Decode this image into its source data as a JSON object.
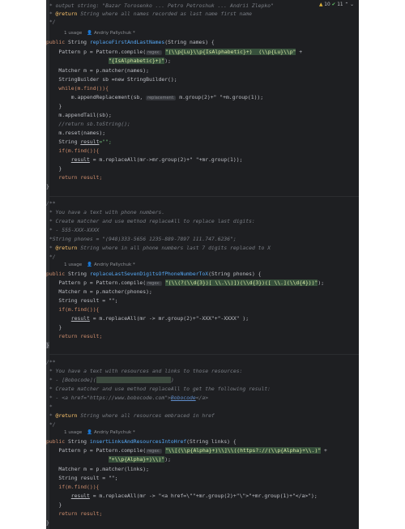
{
  "warnings": {
    "warn_count": "10",
    "ok_count": "11"
  },
  "top": {
    "l1": " * output string: \"Bazar Torosenko ... Petro Petroshuk ... Andrii Zlepko\"",
    "l2_tag": "@return",
    "l2": " String where all names recorded as last name first name",
    "l3": " */"
  },
  "usages": {
    "label": "1 usage",
    "author": "Andriy Pallychuk *"
  },
  "m1": {
    "sig_kw": "public ",
    "sig_type": "String ",
    "sig_name": "replaceFirstAndLastNames",
    "sig_params": "(String names) {",
    "p_decl": "    Pattern p = Pattern.compile(",
    "p_hint": "regex:",
    "p_rx1": "\"(\\\\p{Lu}\\\\p{IsAlphabetic}+)  (\\\\p{Lu}\\\\p\"",
    "p_plus": " +",
    "p_rx2": "\"{IsAlphabetic}+)\"",
    "p_end": ");",
    "m_line": "    Matcher m = p.matcher(names);",
    "sb_line": "    StringBuilder sb =new StringBuilder();",
    "while_line": "    while(m.find()){",
    "append_a": "        m.appendReplacement(sb,",
    "append_hint": "replacement:",
    "append_b": " m.group(2)+\" \"+m.group(1));",
    "close1": "    }",
    "tail": "    m.appendTail(sb);",
    "ret_cm": "    //return sb.toString();",
    "reset": "    m.reset(names);",
    "res_a": "    String ",
    "res_var": "result",
    "res_b": "=\"\";",
    "if_line": "    if(m.find()){",
    "repl_a": "        ",
    "repl_var": "result",
    "repl_b": " = m.replaceAll(mr->mr.group(2)+\" \"+mr.group(1));",
    "close2": "    }",
    "return_line": "    return result;",
    "close3": "}"
  },
  "doc2": {
    "l1": "/**",
    "l2": " * You have a text with phone numbers.",
    "l3": " * Create matcher and use method replaceAll to replace last digits:",
    "l4": " * - 555-XXX-XXXX",
    "l5": " *String phones = \"(948)333-5656 1235-889-7897 111.747.6236\";",
    "l6_tag": "@return",
    "l6": " String where in all phone numbers last 7 digits replaced to X",
    "l7": " */"
  },
  "m2": {
    "sig_kw": "public ",
    "sig_type": "String ",
    "sig_name": "replaceLastSevenDigitsOfPhoneNumberToX",
    "sig_params": "(String phones) {",
    "p_decl": "    Pattern p = Pattern.compile(",
    "p_hint": "regex:",
    "p_rx": "\"(\\\\(?(\\\\d{3})[ \\\\.\\\\)])(\\\\d{3})([ \\\\.](\\\\d{4}))\"",
    "p_end": ");",
    "m_line": "    Matcher m = p.matcher(phones);",
    "res_line": "    String result = \"\";",
    "if_line": "    if(m.find()){",
    "repl_a": "        ",
    "repl_var": "result",
    "repl_b": " = m.replaceAll(mr -> mr.group(2)+\"-XXX\"+\"-XXXX\" );",
    "close1": "    }",
    "return_line": "    return result;",
    "close2": "}"
  },
  "doc3": {
    "l1": "/**",
    "l2": " * You have a text with resources and links to those resources:",
    "l3_a": " * - [Bobocode](",
    "l3_blur": "https://www.bobocode.com",
    "l3_b": ")",
    "l4": " * Create matcher and use method replaceAll to get the following result:",
    "l5_a": " * - <a href=\"https://www.bobocode.com\">",
    "l5_link": "Bobocode",
    "l5_b": "</a>",
    "l6": " *",
    "l7_tag": "@return",
    "l7": " String where all resources embraced in href",
    "l8": " */"
  },
  "m3": {
    "sig_kw": "public ",
    "sig_type": "String ",
    "sig_name": "insertLinksAndResourcesIntoHref",
    "sig_params": "(String links) {",
    "p_decl": "    Pattern p = Pattern.compile(",
    "p_hint": "regex:",
    "p_rx1": "\"\\\\[(\\\\p{Alpha}+)\\\\]\\\\((https?://(\\\\p{Alpha}+\\\\.)\"",
    "p_plus": " +",
    "p_rx2": "\"+\\\\p{Alpha}+)\\\\)\"",
    "p_end": ");",
    "m_line": "    Matcher m = p.matcher(links);",
    "res_line": "    String result = \"\";",
    "if_line": "    if(m.find()){",
    "repl_a": "        ",
    "repl_var": "result",
    "repl_b": " = m.replaceAll(mr -> \"<a href=\\\"\"+mr.group(2)+\"\\\">\"+mr.group(1)+\"</a>\");",
    "close1": "    }",
    "return_line": "    return result;",
    "close2": "}"
  }
}
